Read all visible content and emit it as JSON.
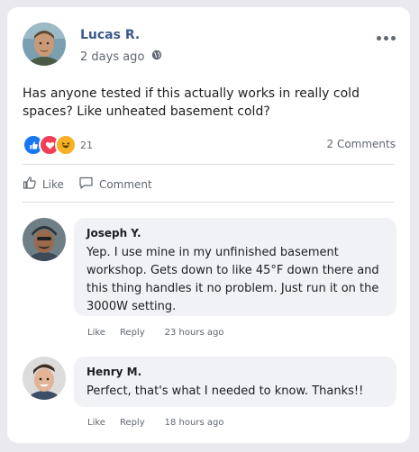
{
  "post": {
    "author": "Lucas R.",
    "time": "2 days ago",
    "privacy_icon": "globe-icon",
    "text": "Has anyone tested if this actually works in really cold spaces? Like unheated basement cold?",
    "reaction_icons": [
      "like-icon",
      "love-icon",
      "haha-icon"
    ],
    "reaction_count": "21",
    "comments_count": "2 Comments"
  },
  "actions": {
    "like_label": "Like",
    "comment_label": "Comment"
  },
  "comments": [
    {
      "author": "Joseph Y.",
      "text": "Yep. I use mine in my unfinished basement workshop. Gets down to like 45°F down there and this thing handles it no problem. Just run it on the 3000W setting.",
      "like_label": "Like",
      "reply_label": "Reply",
      "time": "23 hours ago"
    },
    {
      "author": "Henry M.",
      "text": "Perfect, that's what I needed to know. Thanks!!",
      "like_label": "Like",
      "reply_label": "Reply",
      "time": "18 hours ago"
    }
  ],
  "colors": {
    "author_name": "#3b5a8a",
    "like_blue": "#1877f2",
    "love_red": "#f33e58",
    "haha_yellow": "#f7b125",
    "bubble_bg": "#f0f2f5"
  }
}
